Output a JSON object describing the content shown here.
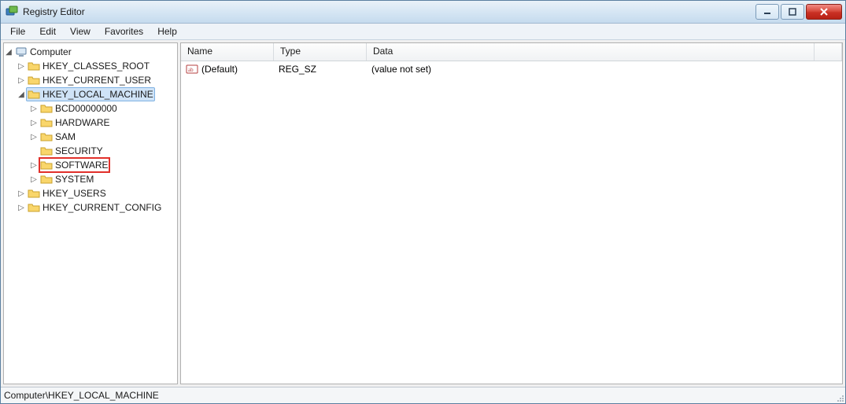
{
  "window": {
    "title": "Registry Editor"
  },
  "menu": {
    "items": [
      "File",
      "Edit",
      "View",
      "Favorites",
      "Help"
    ]
  },
  "tree": {
    "root": {
      "label": "Computer",
      "children": [
        {
          "label": "HKEY_CLASSES_ROOT"
        },
        {
          "label": "HKEY_CURRENT_USER"
        },
        {
          "label": "HKEY_LOCAL_MACHINE",
          "selected": true,
          "expanded": true,
          "children": [
            {
              "label": "BCD00000000"
            },
            {
              "label": "HARDWARE"
            },
            {
              "label": "SAM"
            },
            {
              "label": "SECURITY",
              "no_expander": true
            },
            {
              "label": "SOFTWARE",
              "highlighted": true
            },
            {
              "label": "SYSTEM"
            }
          ]
        },
        {
          "label": "HKEY_USERS"
        },
        {
          "label": "HKEY_CURRENT_CONFIG"
        }
      ]
    }
  },
  "list": {
    "columns": {
      "name": "Name",
      "type": "Type",
      "data": "Data"
    },
    "rows": [
      {
        "name": "(Default)",
        "type": "REG_SZ",
        "data": "(value not set)"
      }
    ]
  },
  "status": {
    "path": "Computer\\HKEY_LOCAL_MACHINE"
  }
}
